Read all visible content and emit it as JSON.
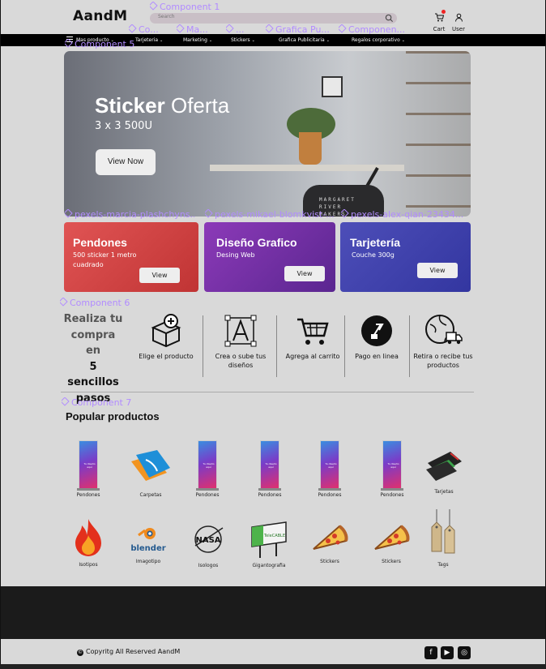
{
  "brand": {
    "logo": "AandM"
  },
  "search": {
    "placeholder": "Search"
  },
  "header": {
    "cart_label": "Cart",
    "user_label": "User"
  },
  "nav": [
    {
      "label": "Mas producto"
    },
    {
      "label": "Tarjeteria"
    },
    {
      "label": "Marketing"
    },
    {
      "label": "Stickers"
    },
    {
      "label": "Grafica Publicitaria"
    },
    {
      "label": "Regalos corporativo"
    }
  ],
  "figma_labels": {
    "component1": "Component 1",
    "co": "Co...",
    "ma": "Ma...",
    "dots": "...",
    "grafica_pu": "Grafica Pu...",
    "componen": "Componen...",
    "component5": "Component 5",
    "layer1": "pexels-marcia-plashchyns...",
    "layer2": "pexels-mikael-blomkvist-...",
    "layer3": "pexels-alex-qian-23434...",
    "component6": "Component 6",
    "component7": "Component 7"
  },
  "hero": {
    "title_bold": "Sticker",
    "title_light": "Oferta",
    "subtitle": "3 x 3 500U",
    "button": "View Now",
    "shirt_text": "MARGARET\nRIVER\nMAKERS"
  },
  "promos": [
    {
      "title": "Pendones",
      "subtitle": "500 sticker 1 metro cuadrado",
      "button": "View",
      "color": "#d94848"
    },
    {
      "title": "Diseño Grafico",
      "subtitle": "Desing Web",
      "button": "View",
      "color": "#7a34aa"
    },
    {
      "title": "Tarjetería",
      "subtitle": "Couche 300g",
      "button": "View",
      "color": "#4242ad"
    }
  ],
  "steps": {
    "title_line1": "Realiza tu",
    "title_line2": "compra en",
    "title_line3": "5 sencillos",
    "title_line4": "pasos",
    "items": [
      {
        "label": "Elige el producto",
        "icon": "box-plus-icon"
      },
      {
        "label": "Crea o sube tus diseños",
        "icon": "design-a-icon"
      },
      {
        "label": "Agrega al carrito",
        "icon": "cart-icon"
      },
      {
        "label": "Pago en linea",
        "icon": "payment-icon"
      },
      {
        "label": "Retira o recibe tus productos",
        "icon": "delivery-icon"
      }
    ]
  },
  "popular": {
    "title": "Popular productos",
    "row1": [
      "Pendones",
      "Carpetas",
      "Pendones",
      "Pendones",
      "Pendones",
      "Pendones",
      "Tarjetas"
    ],
    "row2": [
      "Isotipos",
      "Imagotipo",
      "Isologos",
      "Gigantografia",
      "Stickers",
      "Stickers",
      "Tags"
    ],
    "banner_text": "Tu diseño aquí",
    "blender_text": "blender",
    "nasa_text": "NASA",
    "billboard_text": "TeleCABLE"
  },
  "footer": {
    "copyright": "Copyritg All Reserved AandM",
    "social": [
      "facebook-icon",
      "youtube-icon",
      "instagram-icon"
    ]
  }
}
